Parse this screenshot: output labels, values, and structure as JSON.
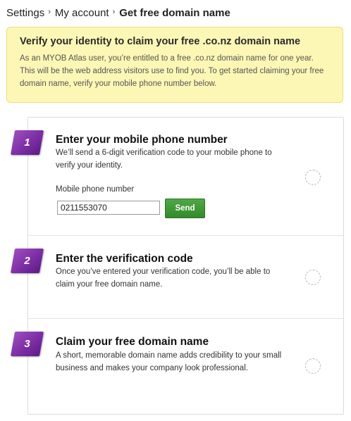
{
  "breadcrumb": {
    "items": [
      "Settings",
      "My account"
    ],
    "current": "Get free domain name",
    "separator": "›"
  },
  "notice": {
    "title": "Verify your identity to claim your free .co.nz domain name",
    "body": "As an MYOB Atlas user, you’re entitled to a free .co.nz domain name for one year. This will be the web address visitors use to find you. To get started claiming your free domain name, verify your mobile phone number below."
  },
  "steps": [
    {
      "number": "1",
      "title": "Enter your mobile phone number",
      "description": "We’ll send a 6-digit verification code to your mobile phone to verify your identity.",
      "field_label": "Mobile phone number",
      "field_value": "0211553070",
      "button_label": "Send"
    },
    {
      "number": "2",
      "title": "Enter the verification code",
      "description": "Once you’ve entered your verification code, you’ll be able to claim your free domain name."
    },
    {
      "number": "3",
      "title": "Claim your free domain name",
      "description": "A short, memorable domain name adds credibility to your small business and makes your company look professional."
    }
  ],
  "colors": {
    "notice_bg": "#fdf7b6",
    "step_badge": "#7d2ea5",
    "send_button": "#3e9a34"
  },
  "icons": {
    "step_status": "dashed-circle-icon"
  }
}
